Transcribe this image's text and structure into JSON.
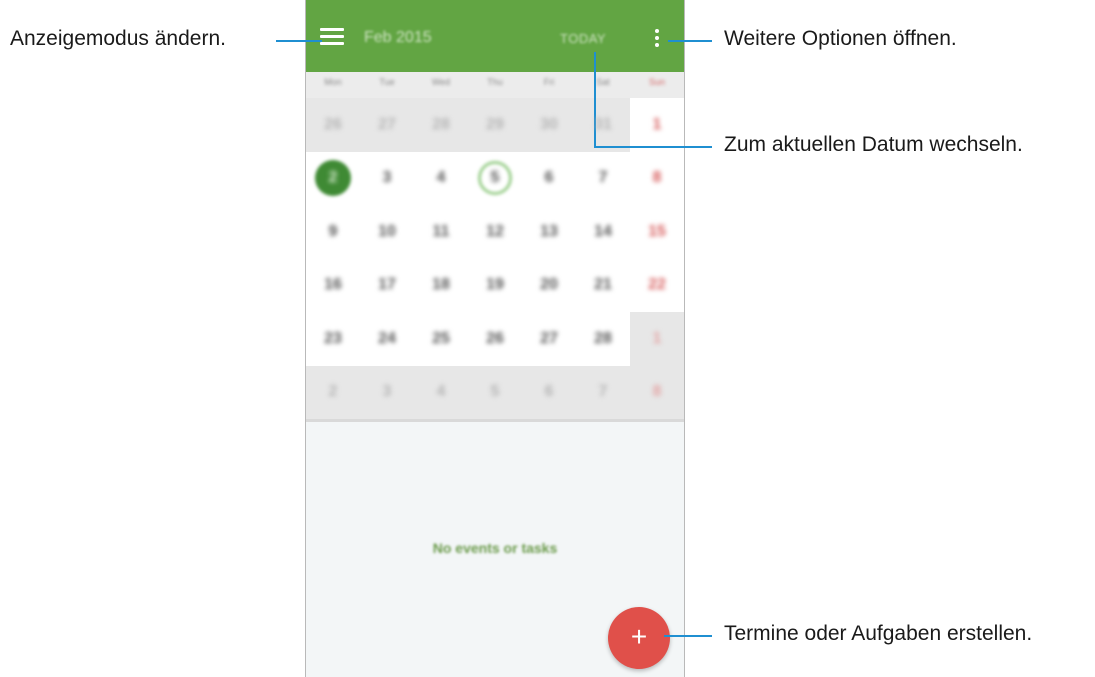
{
  "app": {
    "title": "Feb 2015",
    "today_label": "TODAY",
    "weekdays": [
      "Mon",
      "Tue",
      "Wed",
      "Thu",
      "Fri",
      "Sat",
      "Sun"
    ],
    "weeks": [
      [
        "26",
        "27",
        "28",
        "29",
        "30",
        "31",
        "1"
      ],
      [
        "2",
        "3",
        "4",
        "5",
        "6",
        "7",
        "8"
      ],
      [
        "9",
        "10",
        "11",
        "12",
        "13",
        "14",
        "15"
      ],
      [
        "16",
        "17",
        "18",
        "19",
        "20",
        "21",
        "22"
      ],
      [
        "23",
        "24",
        "25",
        "26",
        "27",
        "28",
        "1"
      ],
      [
        "2",
        "3",
        "4",
        "5",
        "6",
        "7",
        "8"
      ]
    ],
    "selected_day": "2",
    "today_day": "5",
    "empty_message": "No events or tasks",
    "fab_label": "+"
  },
  "callouts": {
    "view_mode": "Anzeigemodus ändern.",
    "more_options": "Weitere Optionen öffnen.",
    "go_today": "Zum aktuellen Datum wechseln.",
    "create": "Termine oder Aufgaben erstellen."
  },
  "colors": {
    "accent_green": "#62a543",
    "fab_red": "#e0504a",
    "callout_line": "#1f8fd1"
  },
  "icons": {
    "menu": "hamburger-menu-icon",
    "more": "vertical-dots-icon"
  }
}
